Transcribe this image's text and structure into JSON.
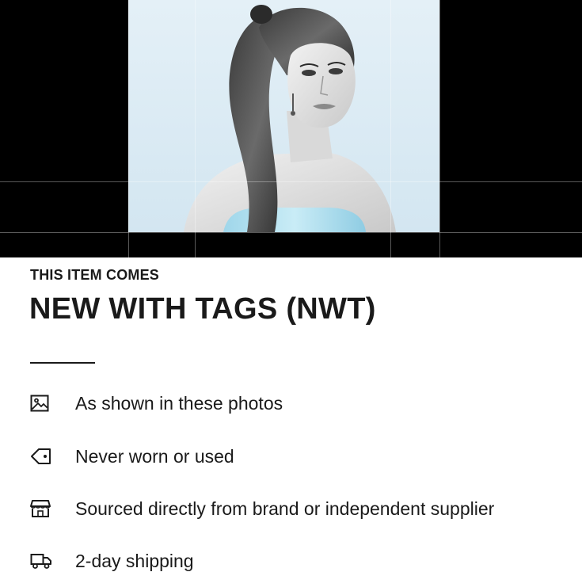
{
  "photo": {
    "icon": "portrait-photo"
  },
  "condition": {
    "eyebrow": "THIS ITEM COMES",
    "headline": "NEW WITH TAGS (NWT)",
    "features": [
      {
        "icon": "image-icon",
        "label": "As shown in these photos"
      },
      {
        "icon": "tag-icon",
        "label": "Never worn or used"
      },
      {
        "icon": "store-icon",
        "label": "Sourced directly from brand or independent supplier"
      },
      {
        "icon": "truck-icon",
        "label": "2-day shipping"
      }
    ]
  },
  "colors": {
    "text": "#1a1a1a",
    "photo_background": "#dcebf4",
    "band_background": "#000000"
  }
}
